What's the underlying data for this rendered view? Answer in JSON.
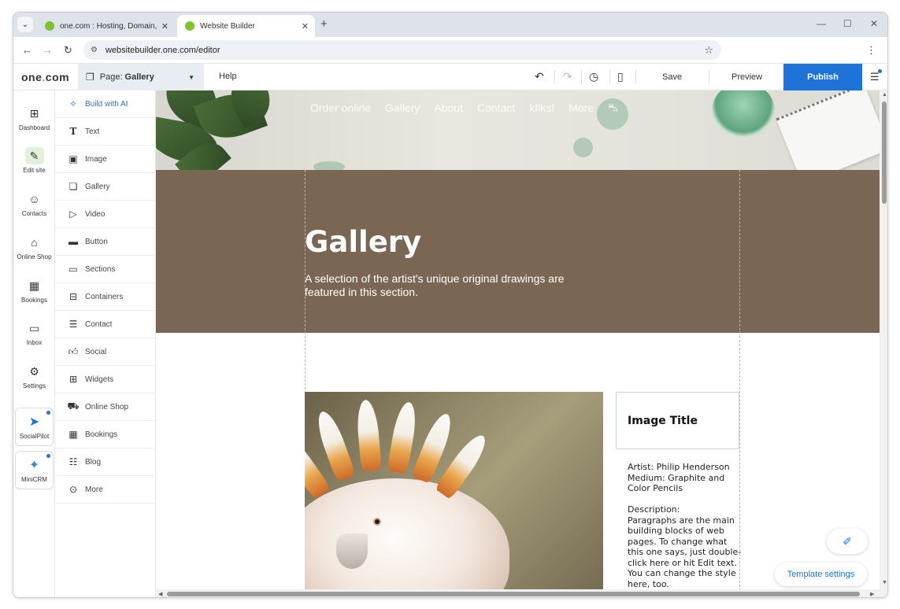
{
  "browser": {
    "tabs": [
      {
        "title": "one.com : Hosting, Domain, Email",
        "close": "✕"
      },
      {
        "title": "Website Builder",
        "close": "✕"
      }
    ],
    "new_tab": "+",
    "url": "websitebuilder.one.com/editor",
    "window_controls": {
      "minimize": "—",
      "maximize": "☐",
      "close": "✕"
    }
  },
  "editor": {
    "logo_text": "one",
    "logo_dot": ".",
    "logo_suffix": "com",
    "page_label": "Page:",
    "page_name": "Gallery",
    "help": "Help",
    "save": "Save",
    "preview": "Preview",
    "publish": "Publish"
  },
  "rail": [
    {
      "label": "Dashboard",
      "icon": "dashboard-icon"
    },
    {
      "label": "Edit site",
      "icon": "edit-site-icon"
    },
    {
      "label": "Contacts",
      "icon": "contacts-icon"
    },
    {
      "label": "Online Shop",
      "icon": "shop-icon"
    },
    {
      "label": "Bookings",
      "icon": "bookings-icon"
    },
    {
      "label": "Inbox",
      "icon": "inbox-icon"
    },
    {
      "label": "Settings",
      "icon": "settings-icon"
    }
  ],
  "rail_apps": [
    {
      "label": "SocialPilot",
      "icon": "socialpilot-icon"
    },
    {
      "label": "MiniCRM",
      "icon": "minicrm-icon"
    }
  ],
  "panel": [
    {
      "label": "Build with AI",
      "icon": "sparkle-icon"
    },
    {
      "label": "Text",
      "icon": "text-icon"
    },
    {
      "label": "Image",
      "icon": "image-icon"
    },
    {
      "label": "Gallery",
      "icon": "gallery-icon"
    },
    {
      "label": "Video",
      "icon": "video-icon"
    },
    {
      "label": "Button",
      "icon": "button-icon"
    },
    {
      "label": "Sections",
      "icon": "sections-icon"
    },
    {
      "label": "Containers",
      "icon": "containers-icon"
    },
    {
      "label": "Contact",
      "icon": "contact-form-icon"
    },
    {
      "label": "Social",
      "icon": "thumbs-up-icon"
    },
    {
      "label": "Widgets",
      "icon": "widgets-icon"
    },
    {
      "label": "Online Shop",
      "icon": "cart-icon"
    },
    {
      "label": "Bookings",
      "icon": "calendar-icon"
    },
    {
      "label": "Blog",
      "icon": "blog-icon"
    },
    {
      "label": "More",
      "icon": "more-icon"
    }
  ],
  "site": {
    "nav": [
      "Order online",
      "Gallery",
      "About",
      "Contact",
      "kflksf",
      "More"
    ],
    "hero_title": "Gallery",
    "hero_subtitle": "A selection of the artist's unique original drawings are featured in this section.",
    "image_title": "Image Title",
    "image_description": "Artist: Philip Henderson\nMedium: Graphite and Color Pencils\n\nDescription:\nParagraphs are the main building blocks of web pages. To change what this one says, just double-click here or hit Edit text. You can change the style here, too."
  },
  "template_settings": "Template settings",
  "colors": {
    "brand_green": "#7ec431",
    "publish_blue": "#1e73d8",
    "hero_brown": "#7a6753"
  }
}
